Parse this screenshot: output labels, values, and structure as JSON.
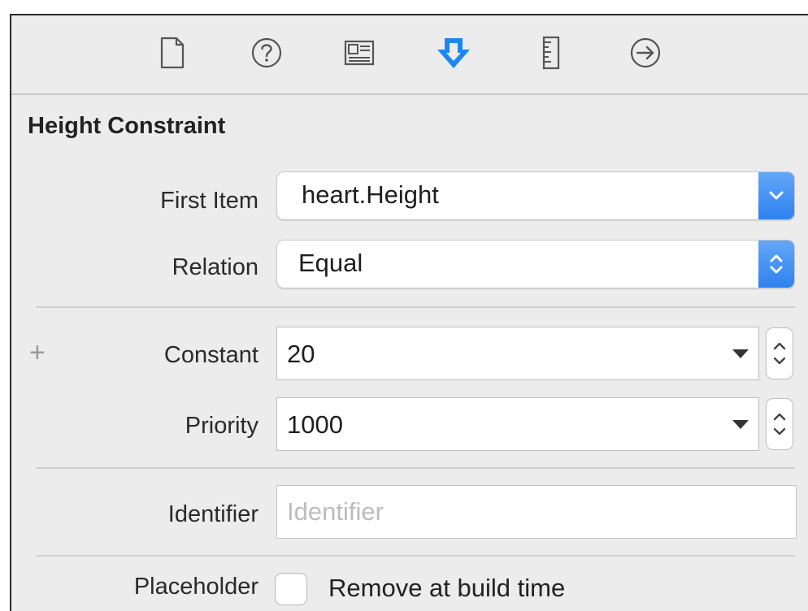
{
  "toolbar": {
    "icons": [
      {
        "name": "file-icon"
      },
      {
        "name": "help-icon"
      },
      {
        "name": "identity-icon"
      },
      {
        "name": "attributes-icon",
        "active": true
      },
      {
        "name": "size-icon"
      },
      {
        "name": "connections-icon"
      }
    ],
    "accent_color": "#1e86f0"
  },
  "section_title": "Height Constraint",
  "first_item": {
    "label": "First Item",
    "value": "heart.Height"
  },
  "relation": {
    "label": "Relation",
    "value": "Equal"
  },
  "constant": {
    "add_symbol": "+",
    "label": "Constant",
    "value": "20"
  },
  "priority": {
    "label": "Priority",
    "value": "1000"
  },
  "identifier": {
    "label": "Identifier",
    "value": "",
    "placeholder": "Identifier"
  },
  "placeholder": {
    "label": "Placeholder",
    "checkbox_label": "Remove at build time",
    "checked": false
  }
}
